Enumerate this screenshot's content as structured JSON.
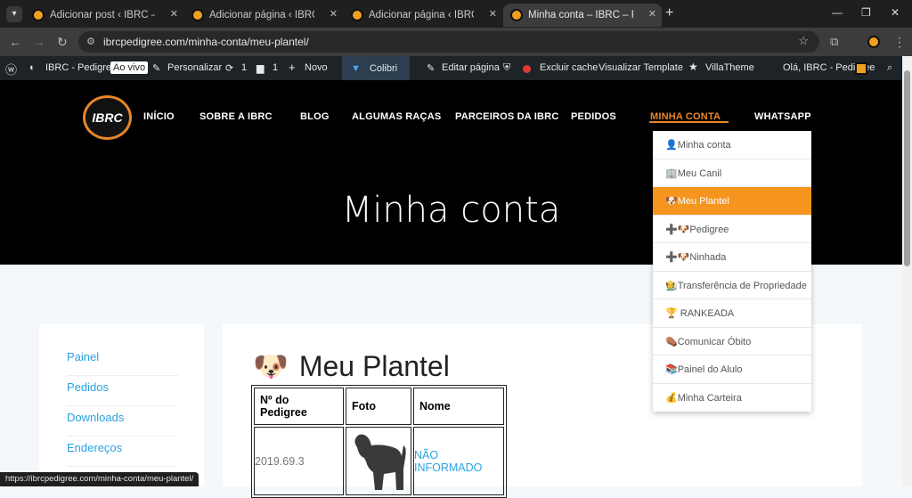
{
  "tabs": [
    {
      "title": "Adicionar post ‹ IBRC – Pedigree"
    },
    {
      "title": "Adicionar página ‹ IBRC – Pedigree"
    },
    {
      "title": "Adicionar página ‹ IBRC – Pedigree"
    },
    {
      "title": "Minha conta – IBRC – Pedigree"
    }
  ],
  "browser": {
    "url": "ibrcpedigree.com/minha-conta/meu-plantel/"
  },
  "adminbar": {
    "site": "IBRC - Pedigree",
    "live": "Ao vivo",
    "customize": "Personalizar",
    "updates": "1",
    "comments": "1",
    "new": "Novo",
    "colibri": "Colibri",
    "edit": "Editar página",
    "cache": "Excluir cache",
    "template": "Visualizar Template",
    "villa": "VillaTheme",
    "greeting": "Olá, IBRC - Pedigree"
  },
  "logo": "IBRC",
  "nav": [
    "INÍCIO",
    "SOBRE A IBRC",
    "BLOG",
    "ALGUMAS RAÇAS",
    "PARCEIROS DA IBRC",
    "PEDIDOS",
    "MINHA CONTA",
    "WHATSAPP"
  ],
  "hero_title": "Minha conta",
  "dropdown": [
    "👤Minha conta",
    "🏢Meu Canil",
    "🐶Meu Plantel",
    "➕🐶Pedigree",
    "➕🐶Ninhada",
    "🧑‍🌾Transferência de Propriedade",
    "🏆 RANKEADA",
    "⚰️Comunicar Óbito",
    "📚Painel do Alulo",
    "💰Minha Carteira"
  ],
  "sidebar": [
    "Painel",
    "Pedidos",
    "Downloads",
    "Endereços"
  ],
  "content": {
    "icon": "🐶",
    "title": "Meu Plantel",
    "headers": [
      "Nº do Pedigree",
      "Foto",
      "Nome"
    ],
    "row": {
      "pedigree": "2019.69.3",
      "nome": "NÃO INFORMADO"
    }
  },
  "status_url": "https://ibrcpedigree.com/minha-conta/meu-plantel/"
}
